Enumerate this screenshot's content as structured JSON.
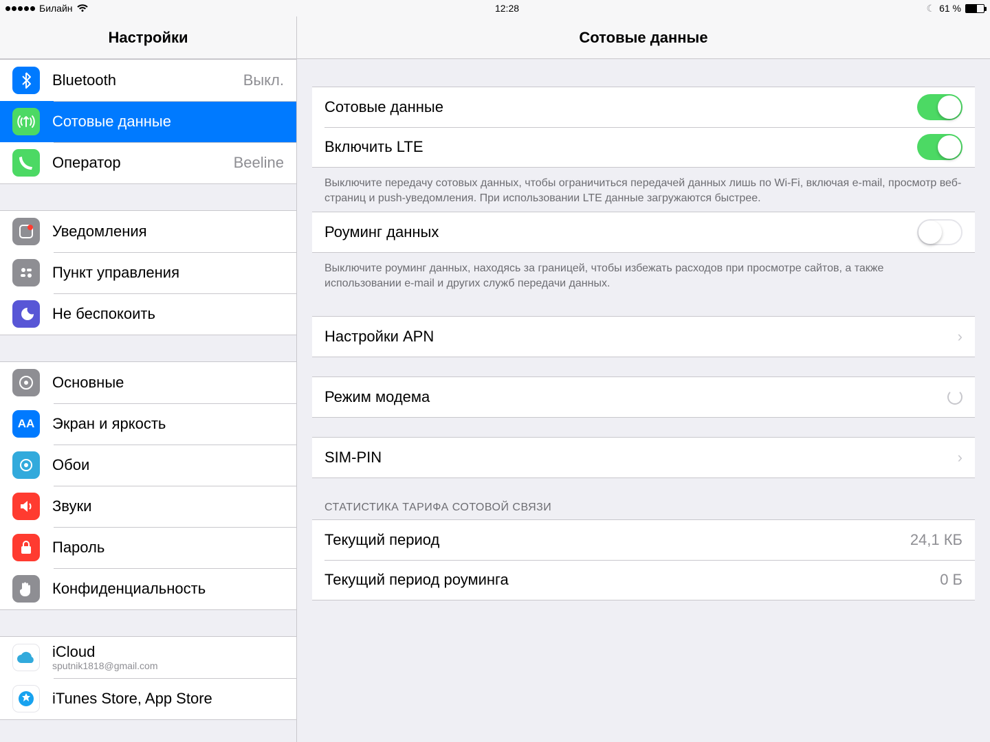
{
  "status": {
    "carrier": "Билайн",
    "time": "12:28",
    "battery_pct": "61 %"
  },
  "sidebar": {
    "title": "Настройки",
    "items": {
      "bluetooth": {
        "label": "Bluetooth",
        "value": "Выкл."
      },
      "cellular": {
        "label": "Сотовые данные"
      },
      "carrier": {
        "label": "Оператор",
        "value": "Beeline"
      },
      "notifications": {
        "label": "Уведомления"
      },
      "control_center": {
        "label": "Пункт управления"
      },
      "dnd": {
        "label": "Не беспокоить"
      },
      "general": {
        "label": "Основные"
      },
      "display": {
        "label": "Экран и яркость"
      },
      "wallpaper": {
        "label": "Обои"
      },
      "sounds": {
        "label": "Звуки"
      },
      "passcode": {
        "label": "Пароль"
      },
      "privacy": {
        "label": "Конфиденциальность"
      },
      "icloud": {
        "label": "iCloud",
        "sublabel": "sputnik1818@gmail.com"
      },
      "itunes": {
        "label": "iTunes Store, App Store"
      }
    }
  },
  "detail": {
    "title": "Сотовые данные",
    "cellular_data": {
      "label": "Сотовые данные",
      "on": true
    },
    "enable_lte": {
      "label": "Включить LTE",
      "on": true
    },
    "note_lte": "Выключите передачу сотовых данных, чтобы ограничиться передачей данных лишь по Wi-Fi, включая e-mail, просмотр веб-страниц и push-уведомления. При использовании LTE данные загружаются быстрее.",
    "roaming": {
      "label": "Роуминг данных",
      "on": false
    },
    "note_roaming": "Выключите роуминг данных, находясь за границей, чтобы избежать расходов при просмотре сайтов, а также использовании e-mail и других служб передачи данных.",
    "apn": {
      "label": "Настройки APN"
    },
    "hotspot": {
      "label": "Режим модема"
    },
    "sim_pin": {
      "label": "SIM-PIN"
    },
    "stats_header": "СТАТИСТИКА ТАРИФА СОТОВОЙ СВЯЗИ",
    "stats_current": {
      "label": "Текущий период",
      "value": "24,1 КБ"
    },
    "stats_roaming": {
      "label": "Текущий период роуминга",
      "value": "0 Б"
    }
  }
}
